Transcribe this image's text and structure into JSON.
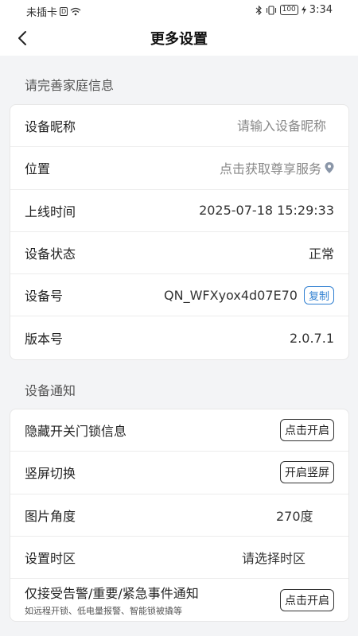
{
  "status_bar": {
    "carrier": "未插卡",
    "battery": "100",
    "time": "3:34"
  },
  "nav": {
    "title": "更多设置"
  },
  "section_family": {
    "title": "请完善家庭信息"
  },
  "device_info": {
    "nickname_label": "设备昵称",
    "nickname_placeholder": "请输入设备昵称",
    "location_label": "位置",
    "location_value": "点击获取尊享服务",
    "online_label": "上线时间",
    "online_value": "2025-07-18 15:29:33",
    "status_label": "设备状态",
    "status_value": "正常",
    "device_id_label": "设备号",
    "device_id_value": "QN_WFXyox4d07E70",
    "copy_label": "复制",
    "version_label": "版本号",
    "version_value": "2.0.7.1"
  },
  "section_notify": {
    "title": "设备通知"
  },
  "notify": {
    "hide_lock_label": "隐藏开关门锁信息",
    "hide_lock_btn": "点击开启",
    "portrait_label": "竖屏切换",
    "portrait_btn": "开启竖屏",
    "angle_label": "图片角度",
    "angle_value": "270度",
    "timezone_label": "设置时区",
    "timezone_value": "请选择时区",
    "alert_label": "仅接受告警/重要/紧急事件通知",
    "alert_sub": "如远程开锁、低电量报警、智能锁被撬等",
    "alert_btn": "点击开启"
  },
  "colors": {
    "accent": "#2f7fd1",
    "background": "#f3f4f6",
    "card": "#ffffff"
  }
}
